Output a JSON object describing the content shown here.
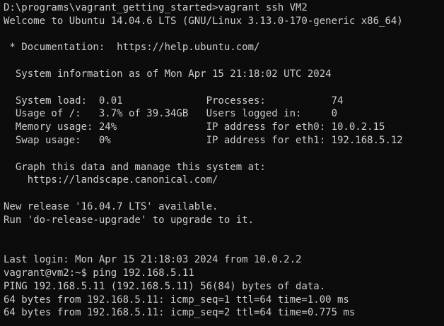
{
  "terminal": {
    "colors": {
      "background": "#0c0c0c",
      "foreground": "#cccccc"
    },
    "lines": [
      "D:\\programs\\vagrant_getting_started>vagrant ssh VM2",
      "Welcome to Ubuntu 14.04.6 LTS (GNU/Linux 3.13.0-170-generic x86_64)",
      "",
      " * Documentation:  https://help.ubuntu.com/",
      "",
      "  System information as of Mon Apr 15 21:18:02 UTC 2024",
      "",
      "  System load:  0.01              Processes:           74",
      "  Usage of /:   3.7% of 39.34GB   Users logged in:     0",
      "  Memory usage: 24%               IP address for eth0: 10.0.2.15",
      "  Swap usage:   0%                IP address for eth1: 192.168.5.12",
      "",
      "  Graph this data and manage this system at:",
      "    https://landscape.canonical.com/",
      "",
      "New release '16.04.7 LTS' available.",
      "Run 'do-release-upgrade' to upgrade to it.",
      "",
      "",
      "Last login: Mon Apr 15 21:18:03 2024 from 10.0.2.2",
      "vagrant@vm2:~$ ping 192.168.5.11",
      "PING 192.168.5.11 (192.168.5.11) 56(84) bytes of data.",
      "64 bytes from 192.168.5.11: icmp_seq=1 ttl=64 time=1.00 ms",
      "64 bytes from 192.168.5.11: icmp_seq=2 ttl=64 time=0.775 ms"
    ]
  }
}
